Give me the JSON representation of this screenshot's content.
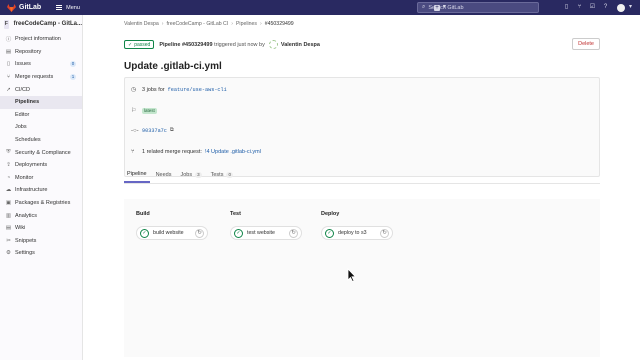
{
  "topbar": {
    "brand": "GitLab",
    "menu_label": "Menu",
    "search_placeholder": "Search GitLab",
    "icons": [
      "plus-icon",
      "chevron-down-icon",
      "issues-icon",
      "merge-request-icon",
      "todo-icon",
      "help-icon",
      "user-avatar"
    ]
  },
  "sidebar": {
    "project_initial": "F",
    "project_name": "freeCodeCamp - GitLa...",
    "items": [
      {
        "label": "Project information",
        "icon": "info-icon"
      },
      {
        "label": "Repository",
        "icon": "book-icon"
      },
      {
        "label": "Issues",
        "icon": "issues-icon",
        "count": "0"
      },
      {
        "label": "Merge requests",
        "icon": "merge-request-icon",
        "count": "1"
      },
      {
        "label": "CI/CD",
        "icon": "rocket-icon"
      },
      {
        "label": "Pipelines",
        "sub": true,
        "active": true
      },
      {
        "label": "Editor",
        "sub": true
      },
      {
        "label": "Jobs",
        "sub": true
      },
      {
        "label": "Schedules",
        "sub": true
      },
      {
        "label": "Security & Compliance",
        "icon": "shield-icon"
      },
      {
        "label": "Deployments",
        "icon": "deployments-icon"
      },
      {
        "label": "Monitor",
        "icon": "monitor-icon"
      },
      {
        "label": "Infrastructure",
        "icon": "cloud-icon"
      },
      {
        "label": "Packages & Registries",
        "icon": "package-icon"
      },
      {
        "label": "Analytics",
        "icon": "chart-icon"
      },
      {
        "label": "Wiki",
        "icon": "book-icon"
      },
      {
        "label": "Snippets",
        "icon": "snippet-icon"
      },
      {
        "label": "Settings",
        "icon": "gear-icon"
      }
    ]
  },
  "breadcrumbs": [
    "Valentin Despa",
    "freeCodeCamp - GitLab CI",
    "Pipelines",
    "#450329499"
  ],
  "pipeline": {
    "status": "passed",
    "id_text": "Pipeline #450329499",
    "triggered_text": "triggered just now by",
    "user": "Valentin Despa",
    "delete_label": "Delete"
  },
  "title": "Update .gitlab-ci.yml",
  "info": {
    "jobs_prefix": "3 jobs for",
    "branch": "feature/use-aws-cli",
    "latest": "latest",
    "commit_sha": "90337a7c",
    "mr_prefix": "1 related merge request:",
    "mr_link": "!4 Update .gitlab-ci.yml"
  },
  "tabs": [
    {
      "label": "Pipeline",
      "active": true
    },
    {
      "label": "Needs"
    },
    {
      "label": "Jobs",
      "count": "3"
    },
    {
      "label": "Tests",
      "count": "0"
    }
  ],
  "stages": [
    {
      "name": "Build",
      "job": "build website"
    },
    {
      "name": "Test",
      "job": "test website"
    },
    {
      "name": "Deploy",
      "job": "deploy to s3"
    }
  ],
  "colors": {
    "topbar": "#292961",
    "success": "#108548",
    "link": "#1f5ea8",
    "danger": "#c03030"
  }
}
